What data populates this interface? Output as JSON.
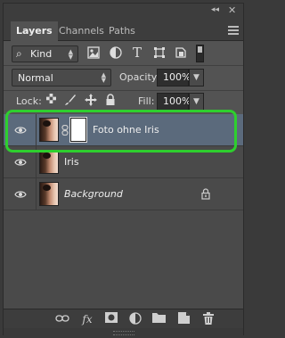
{
  "window": {
    "collapse_glyph": "◂◂",
    "close_glyph": "✕"
  },
  "tabs": [
    {
      "label": "Layers",
      "active": true
    },
    {
      "label": "Channels",
      "active": false
    },
    {
      "label": "Paths",
      "active": false
    }
  ],
  "filter": {
    "kind_label": "Kind",
    "icons": [
      "pixel-filter-icon",
      "adjustment-filter-icon",
      "type-filter-icon",
      "shape-filter-icon",
      "smart-object-filter-icon",
      "filter-toggle-icon"
    ]
  },
  "blend": {
    "mode": "Normal",
    "opacity_label": "Opacity:",
    "opacity_value": "100%"
  },
  "lock": {
    "label": "Lock:",
    "icons": [
      "lock-transparent-icon",
      "lock-image-icon",
      "lock-position-icon",
      "lock-all-icon"
    ],
    "fill_label": "Fill:",
    "fill_value": "100%"
  },
  "layers": [
    {
      "name": "Foto ohne Iris",
      "selected": true,
      "has_mask": true,
      "visible": true
    },
    {
      "name": "Iris",
      "selected": false,
      "has_mask": false,
      "visible": true
    },
    {
      "name": "Background",
      "selected": false,
      "has_mask": false,
      "visible": true,
      "locked": true
    }
  ],
  "bottom_icons": [
    "link-layers-icon",
    "fx-icon",
    "add-mask-icon",
    "adjustment-layer-icon",
    "new-group-icon",
    "new-layer-icon",
    "delete-layer-icon"
  ],
  "fx_text": "fx",
  "colors": {
    "highlight": "#2ecf2e",
    "selected_row": "#5b6a7c"
  }
}
